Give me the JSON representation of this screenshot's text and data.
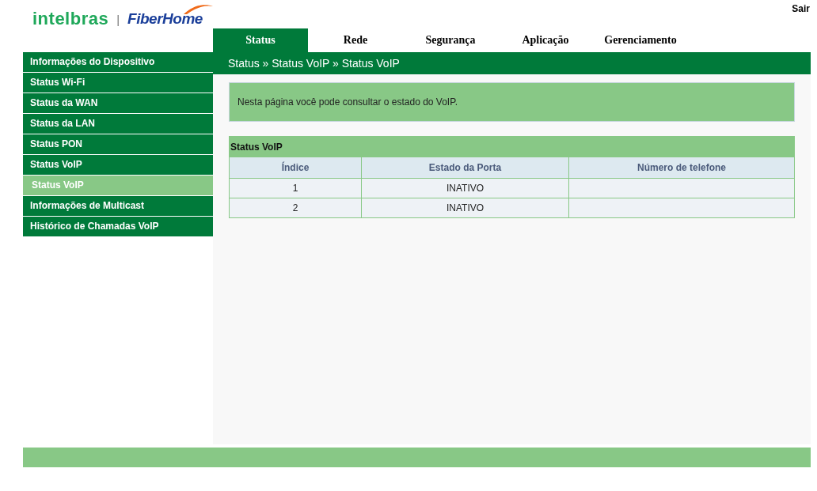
{
  "logo": {
    "brand_primary": "intelbras",
    "separator": "|",
    "brand_secondary": "FiberHome"
  },
  "logout": "Sair",
  "tabs": [
    {
      "label": "Status",
      "selected": true
    },
    {
      "label": "Rede",
      "selected": false
    },
    {
      "label": "Segurança",
      "selected": false
    },
    {
      "label": "Aplicação",
      "selected": false
    },
    {
      "label": "Gerenciamento",
      "selected": false
    }
  ],
  "sidebar": {
    "items": [
      {
        "label": "Informações do Dispositivo",
        "selected": false,
        "sub": false
      },
      {
        "label": "Status Wi-Fi",
        "selected": false,
        "sub": false
      },
      {
        "label": "Status da WAN",
        "selected": false,
        "sub": false
      },
      {
        "label": "Status da LAN",
        "selected": false,
        "sub": false
      },
      {
        "label": "Status PON",
        "selected": false,
        "sub": false
      },
      {
        "label": "Status VoIP",
        "selected": false,
        "sub": false
      },
      {
        "label": "Status VoIP",
        "selected": true,
        "sub": true
      },
      {
        "label": "Informações de Multicast",
        "selected": false,
        "sub": false
      },
      {
        "label": "Histórico de Chamadas VoIP",
        "selected": false,
        "sub": false
      }
    ]
  },
  "breadcrumb": "Status » Status VoIP » Status VoIP",
  "info": "Nesta página você pode consultar o estado do VoIP.",
  "table": {
    "title": "Status VoIP",
    "columns": [
      "Índice",
      "Estado da Porta",
      "Número de telefone"
    ],
    "rows": [
      [
        "1",
        "INATIVO"
      ],
      [
        "2",
        "INATIVO"
      ]
    ]
  }
}
